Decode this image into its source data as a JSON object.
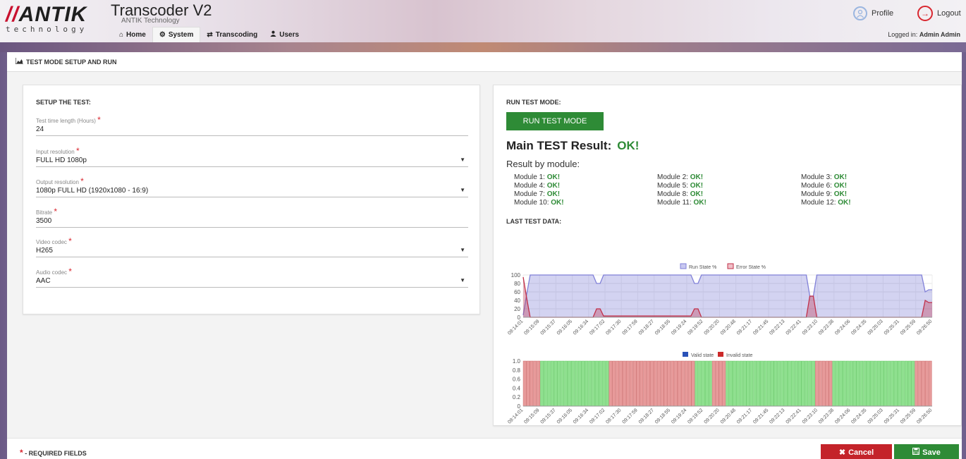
{
  "header": {
    "logo_text": "ANTIK",
    "logo_slashes": "//",
    "logo_sub": "technology",
    "title": "Transcoder V2",
    "subtitle": "ANTIK Technology",
    "nav": [
      {
        "label": "Home",
        "icon": "home-icon",
        "glyph": "⌂"
      },
      {
        "label": "System",
        "icon": "gears-icon",
        "glyph": "⚙"
      },
      {
        "label": "Transcoding",
        "icon": "exchange-icon",
        "glyph": "⇄"
      },
      {
        "label": "Users",
        "icon": "user-icon",
        "glyph": "👤"
      }
    ],
    "active_nav": "System",
    "profile_label": "Profile",
    "logout_label": "Logout",
    "logged_in_prefix": "Logged in:",
    "logged_in_user": "Admin Admin"
  },
  "section_title": "TEST MODE SETUP AND RUN",
  "setup": {
    "heading": "SETUP THE TEST:",
    "fields": [
      {
        "label": "Test time length (Hours)",
        "value": "24",
        "type": "text"
      },
      {
        "label": "Input resolution",
        "value": "FULL HD 1080p",
        "type": "select"
      },
      {
        "label": "Output resolution",
        "value": "1080p FULL HD (1920x1080 - 16:9)",
        "type": "select"
      },
      {
        "label": "Bitrate",
        "value": "3500",
        "type": "text"
      },
      {
        "label": "Video codec",
        "value": "H265",
        "type": "select"
      },
      {
        "label": "Audio codec",
        "value": "AAC",
        "type": "select"
      }
    ]
  },
  "run": {
    "heading": "RUN TEST MODE:",
    "button": "RUN TEST MODE",
    "main_result_label": "Main TEST Result:",
    "main_result_value": "OK!",
    "by_module_label": "Result by module:",
    "modules": [
      {
        "name": "Module 1:",
        "status": "OK!"
      },
      {
        "name": "Module 2:",
        "status": "OK!"
      },
      {
        "name": "Module 3:",
        "status": "OK!"
      },
      {
        "name": "Module 4:",
        "status": "OK!"
      },
      {
        "name": "Module 5:",
        "status": "OK!"
      },
      {
        "name": "Module 6:",
        "status": "OK!"
      },
      {
        "name": "Module 7:",
        "status": "OK!"
      },
      {
        "name": "Module 8:",
        "status": "OK!"
      },
      {
        "name": "Module 9:",
        "status": "OK!"
      },
      {
        "name": "Module 10:",
        "status": "OK!"
      },
      {
        "name": "Module 11:",
        "status": "OK!"
      },
      {
        "name": "Module 12:",
        "status": "OK!"
      }
    ],
    "last_data_label": "LAST TEST DATA:"
  },
  "chart_data": [
    {
      "type": "area",
      "series": [
        {
          "name": "Run State %",
          "color": "#8080d8",
          "values": [
            5,
            55,
            100,
            100,
            100,
            100,
            100,
            100,
            100,
            100,
            100,
            100,
            100,
            100,
            100,
            100,
            100,
            100,
            100,
            100,
            100,
            80,
            80,
            100,
            100,
            100,
            100,
            100,
            100,
            100,
            100,
            100,
            100,
            100,
            100,
            100,
            100,
            100,
            100,
            100,
            100,
            100,
            100,
            100,
            100,
            100,
            100,
            100,
            100,
            80,
            80,
            100,
            100,
            100,
            100,
            100,
            100,
            100,
            100,
            100,
            100,
            100,
            100,
            100,
            100,
            100,
            100,
            100,
            100,
            100,
            100,
            100,
            100,
            100,
            100,
            100,
            100,
            100,
            100,
            100,
            100,
            100,
            50,
            50,
            100,
            100,
            100,
            100,
            100,
            100,
            100,
            100,
            100,
            100,
            100,
            100,
            100,
            100,
            100,
            100,
            100,
            100,
            100,
            100,
            100,
            100,
            100,
            100,
            100,
            100,
            100,
            100,
            100,
            100,
            100,
            60,
            65,
            65
          ]
        },
        {
          "name": "Error State %",
          "color": "#c0304a",
          "values": [
            95,
            45,
            0,
            0,
            0,
            0,
            0,
            0,
            0,
            0,
            0,
            0,
            0,
            0,
            0,
            0,
            0,
            0,
            0,
            0,
            0,
            20,
            20,
            3,
            3,
            3,
            3,
            3,
            3,
            3,
            3,
            3,
            3,
            3,
            3,
            3,
            3,
            3,
            3,
            3,
            3,
            3,
            3,
            3,
            3,
            3,
            3,
            3,
            3,
            20,
            20,
            0,
            0,
            0,
            0,
            0,
            0,
            0,
            0,
            0,
            0,
            0,
            0,
            0,
            0,
            0,
            0,
            0,
            0,
            0,
            0,
            0,
            0,
            0,
            0,
            0,
            0,
            0,
            0,
            0,
            0,
            0,
            50,
            50,
            0,
            0,
            0,
            0,
            0,
            0,
            0,
            0,
            0,
            0,
            0,
            0,
            0,
            0,
            0,
            0,
            0,
            0,
            0,
            0,
            0,
            0,
            0,
            0,
            0,
            0,
            0,
            0,
            0,
            0,
            0,
            40,
            35,
            35
          ]
        }
      ],
      "ylim": [
        0,
        100
      ],
      "yticks": [
        "0",
        "20",
        "40",
        "60",
        "80",
        "100"
      ],
      "categories": [
        "09:14:01",
        "09:15:09",
        "09:15:37",
        "09:16:05",
        "09:16:34",
        "09:17:02",
        "09:17:30",
        "09:17:59",
        "09:18:27",
        "09:18:55",
        "09:19:24",
        "09:19:52",
        "09:20:20",
        "09:20:48",
        "09:21:17",
        "09:21:45",
        "09:22:13",
        "09:22:41",
        "09:23:10",
        "09:23:38",
        "09:24:06",
        "09:24:35",
        "09:25:03",
        "09:25:31",
        "09:25:59",
        "09:26:50"
      ],
      "legend": "top-center"
    },
    {
      "type": "bar",
      "series": [
        {
          "name": "Valid state",
          "color": "#2a52b8"
        },
        {
          "name": "Invalid state",
          "color": "#cc2a2a"
        }
      ],
      "ylim": [
        0,
        1.0
      ],
      "yticks": [
        "0",
        "0.2",
        "0.4",
        "0.6",
        "0.8",
        "1.0"
      ],
      "segments": [
        {
          "state": "invalid",
          "length": 5
        },
        {
          "state": "valid",
          "length": 20
        },
        {
          "state": "invalid",
          "length": 25
        },
        {
          "state": "valid",
          "length": 5
        },
        {
          "state": "invalid",
          "length": 4
        },
        {
          "state": "valid",
          "length": 26
        },
        {
          "state": "invalid",
          "length": 5
        },
        {
          "state": "valid",
          "length": 24
        },
        {
          "state": "invalid",
          "length": 5
        }
      ],
      "categories": [
        "09:14:01",
        "09:15:09",
        "09:15:37",
        "09:16:05",
        "09:16:34",
        "09:17:02",
        "09:17:30",
        "09:17:59",
        "09:18:27",
        "09:18:55",
        "09:19:24",
        "09:19:52",
        "09:20:20",
        "09:20:48",
        "09:21:17",
        "09:21:45",
        "09:22:13",
        "09:22:41",
        "09:23:10",
        "09:23:38",
        "09:24:06",
        "09:24:35",
        "09:25:03",
        "09:25:31",
        "09:25:59",
        "09:26:50"
      ],
      "legend": "top-center"
    }
  ],
  "footer": {
    "required_note": "- REQUIRED FIELDS",
    "cancel_label": "Cancel",
    "save_label": "Save"
  },
  "colors": {
    "accent_green": "#2e8b36",
    "cancel_red": "#c4232a",
    "required_red": "#d9262f"
  }
}
